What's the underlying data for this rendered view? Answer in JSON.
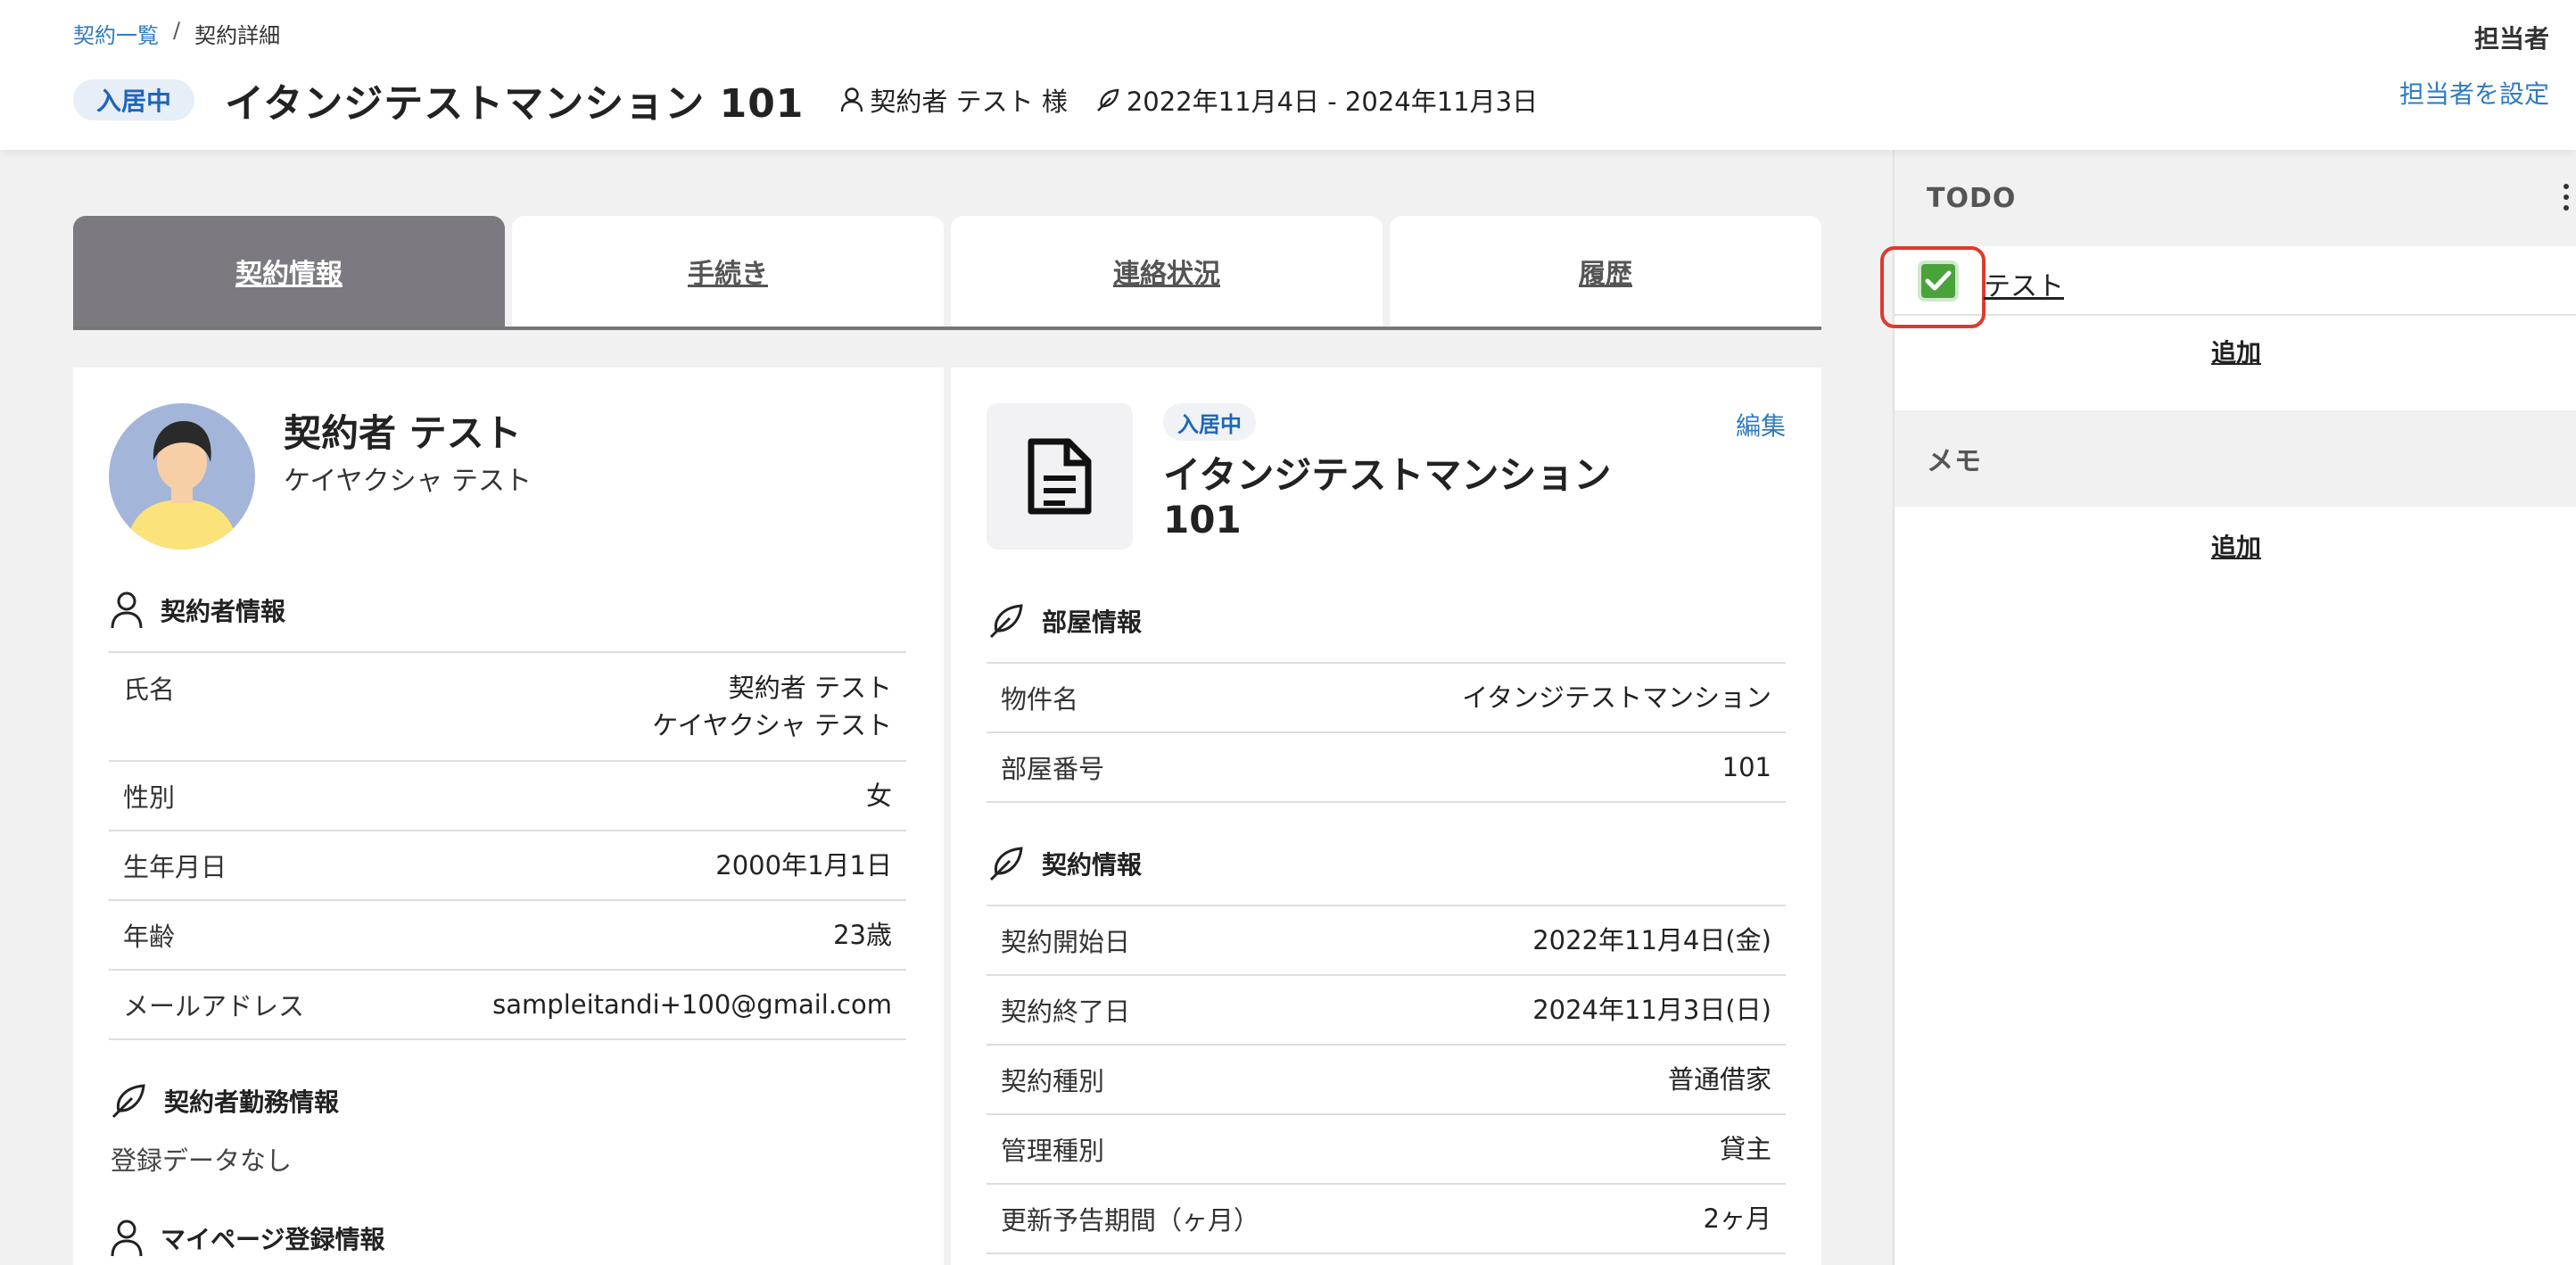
{
  "breadcrumb": {
    "list": "契約一覧",
    "sep": "/",
    "current": "契約詳細"
  },
  "header": {
    "status": "入居中",
    "title": "イタンジテストマンション 101",
    "contractor": "契約者 テスト 様",
    "period": "2022年11月4日 - 2024年11月3日",
    "assignee_title": "担当者",
    "assignee_link": "担当者を設定"
  },
  "tabs": [
    {
      "label": "契約情報",
      "active": true
    },
    {
      "label": "手続き"
    },
    {
      "label": "連絡状況"
    },
    {
      "label": "履歴"
    }
  ],
  "left": {
    "name": "契約者 テスト",
    "kana": "ケイヤクシャ テスト",
    "contractor_info_title": "契約者情報",
    "rows": [
      {
        "label": "氏名",
        "value": "契約者 テスト",
        "value2": "ケイヤクシャ テスト"
      },
      {
        "label": "性別",
        "value": "女"
      },
      {
        "label": "生年月日",
        "value": "2000年1月1日"
      },
      {
        "label": "年齢",
        "value": "23歳"
      },
      {
        "label": "メールアドレス",
        "value": "sampleitandi+100@gmail.com"
      }
    ],
    "work_title": "契約者勤務情報",
    "no_data": "登録データなし",
    "mypage_title": "マイページ登録情報"
  },
  "right": {
    "status": "入居中",
    "edit": "編集",
    "title_line1": "イタンジテストマンション",
    "title_line2": "101",
    "room_title": "部屋情報",
    "room_rows": [
      {
        "label": "物件名",
        "value": "イタンジテストマンション"
      },
      {
        "label": "部屋番号",
        "value": "101"
      }
    ],
    "contract_title": "契約情報",
    "contract_rows": [
      {
        "label": "契約開始日",
        "value": "2022年11月4日(金)"
      },
      {
        "label": "契約終了日",
        "value": "2024年11月3日(日)"
      },
      {
        "label": "契約種別",
        "value": "普通借家"
      },
      {
        "label": "管理種別",
        "value": "貸主"
      },
      {
        "label": "更新予告期間（ヶ月）",
        "value": "2ヶ月"
      }
    ]
  },
  "side": {
    "todo_title": "TODO",
    "todo_item": "テスト",
    "todo_checked": true,
    "todo_add": "追加",
    "memo_title": "メモ",
    "memo_add": "追加"
  },
  "colors": {
    "accent": "#2f7cc4",
    "active_tab": "#7c7a80",
    "check": "#4aa23a",
    "highlight": "#dd3a2e"
  }
}
